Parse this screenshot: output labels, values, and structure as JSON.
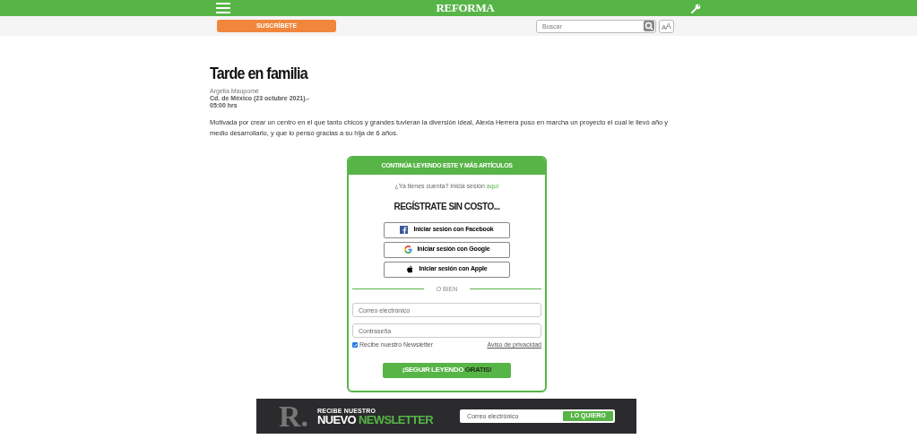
{
  "header": {
    "logo": "REFORMA"
  },
  "subheader": {
    "subscribe_button": "SUSCRÍBETE",
    "search": {
      "placeholder": "Buscar"
    },
    "font_size_button": {
      "small": "A",
      "large": "A"
    }
  },
  "article": {
    "title": "Tarde en familia",
    "author": "Argelia Maupomé",
    "dateline": "Cd. de México (23 octubre 2021).-",
    "time": "05:00 hrs",
    "body": "Motivada por crear un centro en el que tanto chicos y grandes tuvieran la diversión ideal, Alexia Herrera puso en marcha un proyecto el cual le llevó año y medio desarrollarlo, y que lo pensó gracias a su hija de 6 años."
  },
  "paywall": {
    "heading": "CONTINÚA LEYENDO ESTE Y MÁS ARTÍCULOS",
    "account_prompt": "¿Ya tienes cuenta? Inicia sesión",
    "login_link": "aquí",
    "register_title": "REGÍSTRATE SIN COSTO...",
    "social_buttons": [
      {
        "kind": "facebook",
        "label": "Iniciar sesión con Facebook"
      },
      {
        "kind": "google",
        "label": "Iniciar sesión con Google"
      },
      {
        "kind": "apple",
        "label": "Iniciar sesión con Apple"
      }
    ],
    "divider": "O BIEN",
    "email": {
      "placeholder": "Correo electrónico"
    },
    "password": {
      "placeholder": "Contraseña"
    },
    "newsletter_opt_in": {
      "label": "Recibe nuestro Newsletter",
      "checked": true
    },
    "privacy_link": "Aviso de privacidad",
    "submit_button": {
      "part_1": "¡SEGUIR LEYENDO",
      "part_2": "GRATIS!"
    }
  },
  "newsletter_banner": {
    "logo": "R.",
    "line_1": "RECIBE NUESTRO",
    "line_2a": "NUEVO",
    "line_2b": "NEWSLETTER",
    "email": {
      "placeholder": "Correo electrónico"
    },
    "button": "LO QUIERO"
  }
}
